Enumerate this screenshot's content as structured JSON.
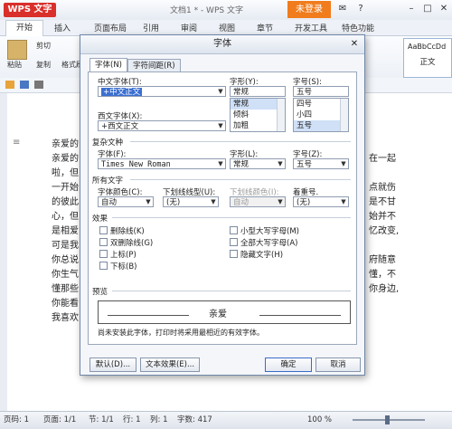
{
  "app": {
    "logo": "WPS 文字",
    "doc_tab": "文档1 * - WPS 文字",
    "login": "未登录"
  },
  "ribbon_tabs": [
    "开始",
    "插入",
    "页面布局",
    "引用",
    "审阅",
    "视图",
    "章节",
    "开发工具",
    "特色功能"
  ],
  "ribbon": {
    "cut": "剪切",
    "paste": "粘贴",
    "copy": "复制",
    "format_painter": "格式刷",
    "style_sample": "AaBbCcDd",
    "style_name": "正文"
  },
  "document_lines": [
    "亲爱的",
    "亲爱的",
    "啦，但",
    "一开始",
    "的彼此",
    "心，但",
    "是相爱",
    "可是我",
    "你总说",
    "你生气",
    "懂那些",
    "你能看",
    "我喜欢"
  ],
  "document_right": [
    "在一起",
    "点就伤",
    "是不甘",
    "始并不",
    "忆改变,",
    "府随意",
    "懂，不",
    "你身边,"
  ],
  "dialog": {
    "title": "字体",
    "tabs": [
      "字体(N)",
      "字符间距(R)"
    ],
    "cn_font_label": "中文字体(T):",
    "cn_font_value": "+中文正文",
    "style_label": "字形(Y):",
    "style_value": "常规",
    "style_options": [
      "常规",
      "倾斜",
      "加粗"
    ],
    "size_label": "字号(S):",
    "size_value": "五号",
    "size_options": [
      "四号",
      "小四",
      "五号"
    ],
    "west_font_label": "西文字体(X):",
    "west_font_value": "+西文正文",
    "complex_section": "复杂文种",
    "complex_font_label": "字体(F):",
    "complex_font_value": "Times New Roman",
    "complex_style_label": "字形(L):",
    "complex_style_value": "常规",
    "complex_size_label": "字号(Z):",
    "complex_size_value": "五号",
    "all_text_section": "所有文字",
    "font_color_label": "字体颜色(C):",
    "font_color_value": "自动",
    "underline_label": "下划线线型(U):",
    "underline_value": "(无)",
    "underline_color_label": "下划线颜色(I):",
    "underline_color_value": "自动",
    "emphasis_label": "着重号.",
    "emphasis_value": "(无)",
    "effects_section": "效果",
    "effects_left": [
      "删除线(K)",
      "双删除线(G)",
      "上标(P)",
      "下标(B)"
    ],
    "effects_right": [
      "小型大写字母(M)",
      "全部大写字母(A)",
      "隐藏文字(H)"
    ],
    "preview_section": "预览",
    "preview_text": "亲爱",
    "note": "尚未安装此字体，打印时将采用最相近的有效字体。",
    "buttons": {
      "default": "默认(D)...",
      "text_effects": "文本效果(E)...",
      "ok": "确定",
      "cancel": "取消"
    }
  },
  "status": {
    "page": "页码: 1",
    "pages": "页面: 1/1",
    "section": "节: 1/1",
    "row": "行: 1",
    "col": "列: 1",
    "words": "字数: 417",
    "zoom": "100 %"
  },
  "colors": {
    "accent_red": "#d9302b",
    "login_orange": "#f07c1d",
    "selection_blue": "#3b6fd1"
  }
}
